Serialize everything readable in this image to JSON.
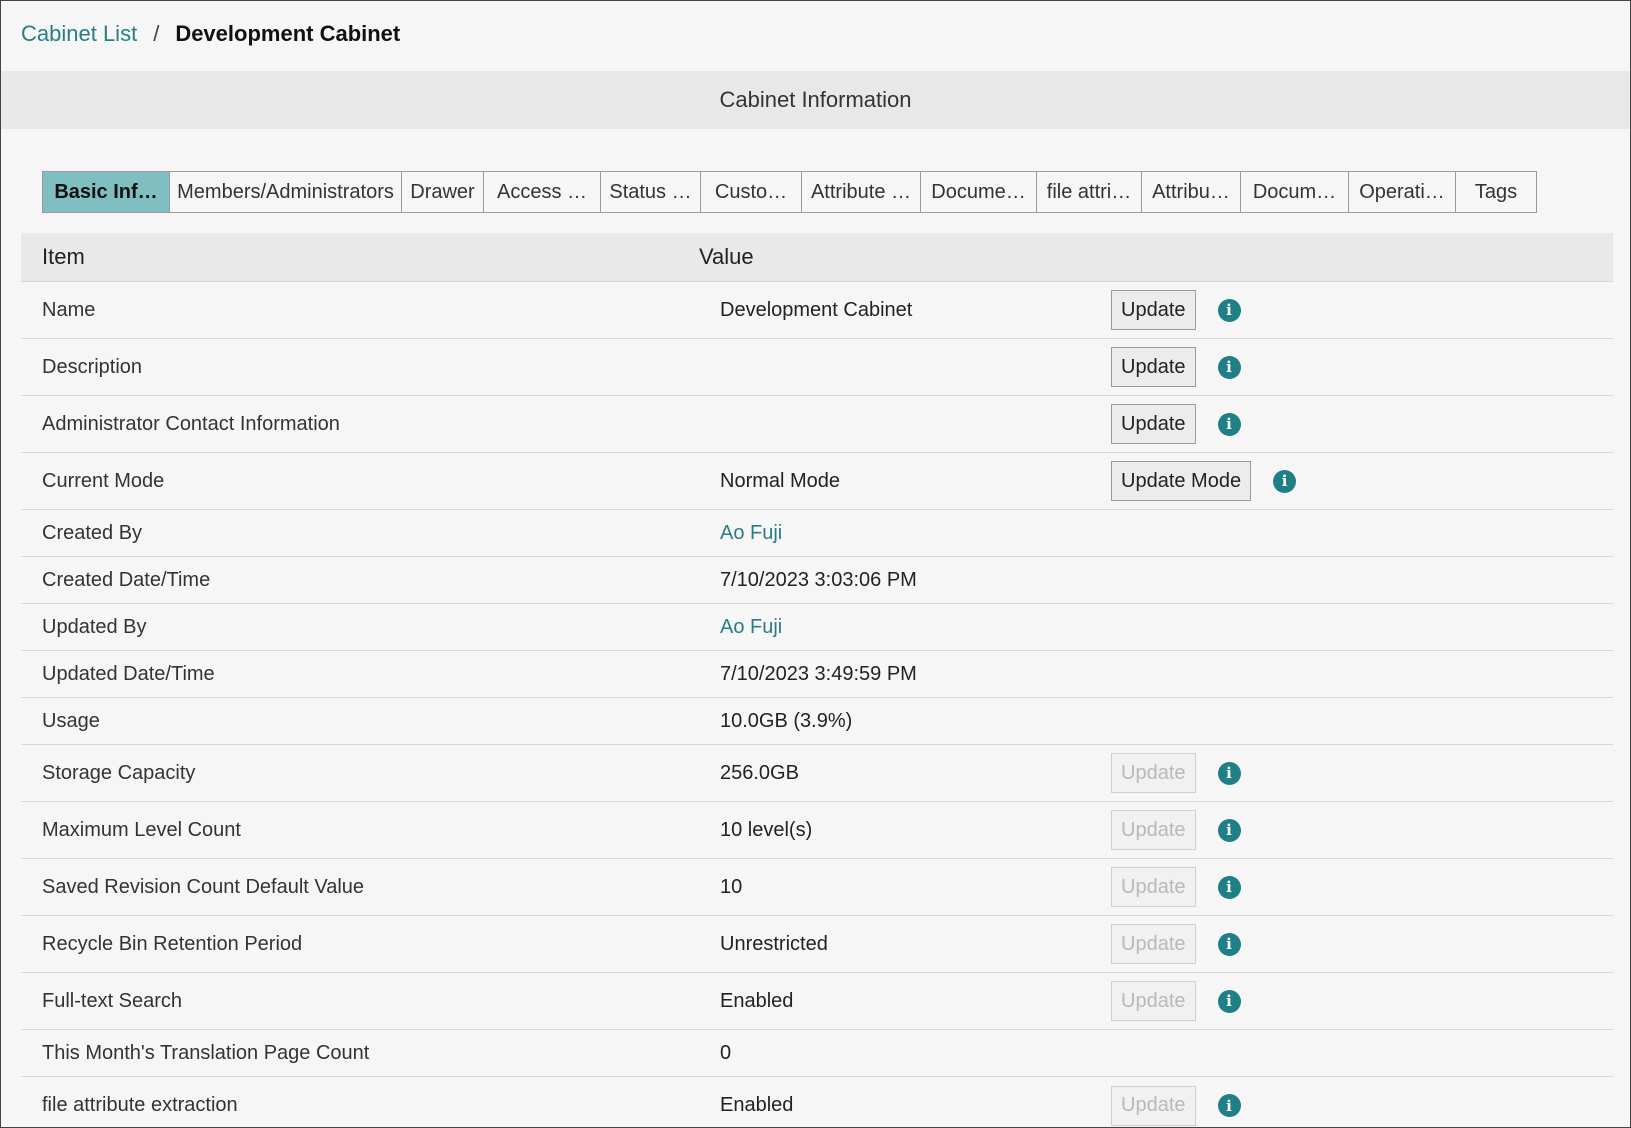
{
  "breadcrumb": {
    "root": "Cabinet List",
    "separator": "/",
    "current": "Development Cabinet"
  },
  "section": {
    "title": "Cabinet Information"
  },
  "tabs": [
    {
      "label": "Basic Inf…",
      "active": true
    },
    {
      "label": "Members/Administrators"
    },
    {
      "label": "Drawer"
    },
    {
      "label": "Access …"
    },
    {
      "label": "Status …"
    },
    {
      "label": "Custo…"
    },
    {
      "label": "Attribute …"
    },
    {
      "label": "Docume…"
    },
    {
      "label": "file attri…"
    },
    {
      "label": "Attribu…"
    },
    {
      "label": "Docum…"
    },
    {
      "label": "Operati…"
    },
    {
      "label": "Tags"
    }
  ],
  "table": {
    "headers": {
      "item": "Item",
      "value": "Value"
    },
    "rows": [
      {
        "item": "Name",
        "value": "Development Cabinet",
        "button": "Update"
      },
      {
        "item": "Description",
        "value": "",
        "button": "Update"
      },
      {
        "item": "Administrator Contact Information",
        "value": "",
        "button": "Update"
      },
      {
        "item": "Current Mode",
        "value": "Normal Mode",
        "button": "Update Mode"
      },
      {
        "item": "Created By",
        "value": "Ao Fuji"
      },
      {
        "item": "Created Date/Time",
        "value": "7/10/2023 3:03:06 PM"
      },
      {
        "item": "Updated By",
        "value": "Ao Fuji"
      },
      {
        "item": "Updated Date/Time",
        "value": "7/10/2023 3:49:59 PM"
      },
      {
        "item": "Usage",
        "value": "10.0GB (3.9%)"
      },
      {
        "item": "Storage Capacity",
        "value": "256.0GB",
        "button": "Update",
        "disabled": true
      },
      {
        "item": "Maximum Level Count",
        "value": "10 level(s)",
        "button": "Update",
        "disabled": true
      },
      {
        "item": "Saved Revision Count Default Value",
        "value": "10",
        "button": "Update",
        "disabled": true
      },
      {
        "item": "Recycle Bin Retention Period",
        "value": "Unrestricted",
        "button": "Update",
        "disabled": true
      },
      {
        "item": "Full-text Search",
        "value": "Enabled",
        "button": "Update",
        "disabled": true
      },
      {
        "item": "This Month's Translation Page Count",
        "value": "0"
      },
      {
        "item": "file attribute extraction",
        "value": "Enabled",
        "button": "Update",
        "disabled": true
      }
    ]
  },
  "icons": {
    "info": "info-icon",
    "info_glyph": "i"
  },
  "colors": {
    "accent": "#2a7d84",
    "active_tab": "#7fbfc1",
    "info": "#1f7f86"
  }
}
